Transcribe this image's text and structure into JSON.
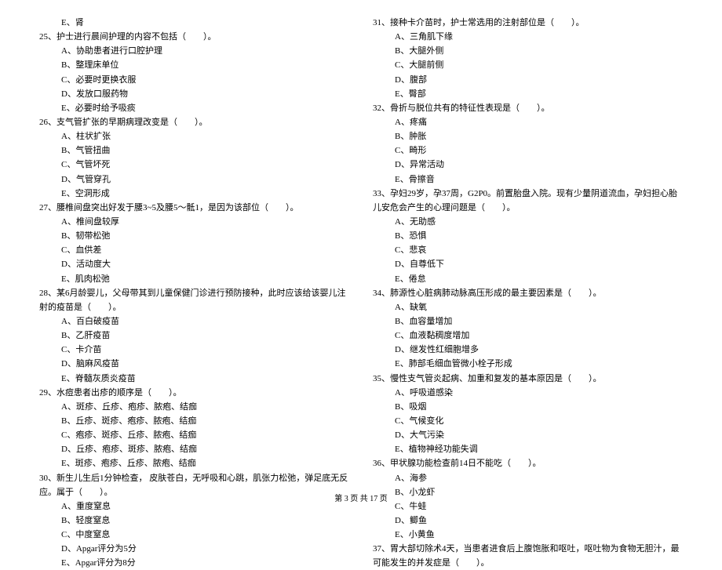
{
  "footer": "第 3 页 共 17 页",
  "left": {
    "q24_e": "E、肾",
    "q25": "25、护士进行晨间护理的内容不包括（　　）。",
    "q25_opts": [
      "A、协助患者进行口腔护理",
      "B、整理床单位",
      "C、必要时更换衣服",
      "D、发放口服药物",
      "E、必要时给予吸痰"
    ],
    "q26": "26、支气管扩张的早期病理改变是（　　）。",
    "q26_opts": [
      "A、柱状扩张",
      "B、气管扭曲",
      "C、气管坏死",
      "D、气管穿孔",
      "E、空洞形成"
    ],
    "q27": "27、腰椎间盘突出好发于腰3~5及腰5～骶1，是因为该部位（　　）。",
    "q27_opts": [
      "A、椎间盘较厚",
      "B、韧带松弛",
      "C、血供差",
      "D、活动度大",
      "E、肌肉松弛"
    ],
    "q28": "28、某6月龄婴儿，父母带其到儿童保健门诊进行预防接种，此时应该给该婴儿注射的疫苗是（　　）。",
    "q28_opts": [
      "A、百白破疫苗",
      "B、乙肝疫苗",
      "C、卡介苗",
      "D、脑麻风疫苗",
      "E、脊髓灰质炎疫苗"
    ],
    "q29": "29、水痘患者出疹的顺序是（　　）。",
    "q29_opts": [
      "A、斑疹、丘疹、疱疹、脓疱、结痂",
      "B、丘疹、斑疹、疱疹、脓疱、结痂",
      "C、疱疹、斑疹、丘疹、脓疱、结痂",
      "D、丘疹、疱疹、斑疹、脓疱、结痂",
      "E、斑疹、疱疹、丘疹、脓疱、结痂"
    ],
    "q30": "30、新生儿生后1分钟检查， 皮肤苍白，无呼吸和心跳，肌张力松弛，弹足底无反应。属于（　　）。",
    "q30_opts": [
      "A、重度窒息",
      "B、轻度窒息",
      "C、中度窒息",
      "D、Apgar评分为5分",
      "E、Apgar评分为8分"
    ]
  },
  "right": {
    "q31": "31、接种卡介苗时，护士常选用的注射部位是（　　）。",
    "q31_opts": [
      "A、三角肌下缘",
      "B、大腿外侧",
      "C、大腿前侧",
      "D、腹部",
      "E、臀部"
    ],
    "q32": "32、骨折与脱位共有的特征性表现是（　　）。",
    "q32_opts": [
      "A、疼痛",
      "B、肿胀",
      "C、畸形",
      "D、异常活动",
      "E、骨擦音"
    ],
    "q33": "33、孕妇29岁，孕37周，G2P0。前置胎盘入院。现有少量阴道流血，孕妇担心胎儿安危会产生的心理问题是（　　）。",
    "q33_opts": [
      "A、无助感",
      "B、恐惧",
      "C、悲哀",
      "D、自尊低下",
      "E、倦怠"
    ],
    "q34": "34、肺源性心脏病肺动脉高压形成的最主要因素是（　　）。",
    "q34_opts": [
      "A、缺氧",
      "B、血容量增加",
      "C、血液黏稠度增加",
      "D、继发性红细胞增多",
      "E、肺部毛细血管微小栓子形成"
    ],
    "q35": "35、慢性支气管炎起病、加重和复发的基本原因是（　　）。",
    "q35_opts": [
      "A、呼吸道感染",
      "B、吸烟",
      "C、气候变化",
      "D、大气污染",
      "E、植物神经功能失调"
    ],
    "q36": "36、甲状腺功能检查前14日不能吃（　　）。",
    "q36_opts": [
      "A、海参",
      "B、小龙虾",
      "C、牛蛙",
      "D、鲫鱼",
      "E、小黄鱼"
    ],
    "q37": "37、胃大部切除术4天，当患者进食后上腹饱胀和呕吐，呕吐物为食物无胆汁，最可能发生的并发症是（　　）。"
  }
}
